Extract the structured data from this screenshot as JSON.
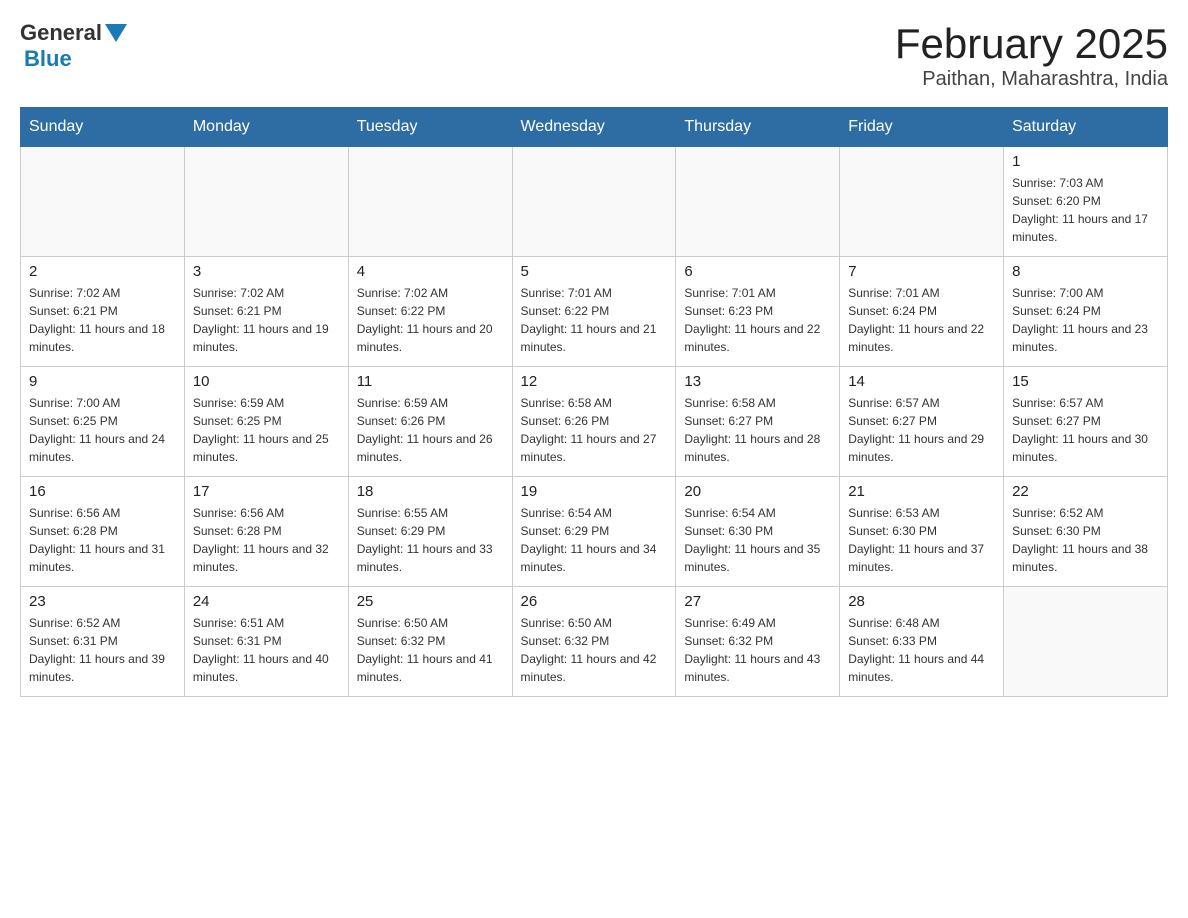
{
  "header": {
    "title": "February 2025",
    "subtitle": "Paithan, Maharashtra, India",
    "logo_general": "General",
    "logo_blue": "Blue"
  },
  "calendar": {
    "weekdays": [
      "Sunday",
      "Monday",
      "Tuesday",
      "Wednesday",
      "Thursday",
      "Friday",
      "Saturday"
    ],
    "weeks": [
      [
        {
          "day": "",
          "info": ""
        },
        {
          "day": "",
          "info": ""
        },
        {
          "day": "",
          "info": ""
        },
        {
          "day": "",
          "info": ""
        },
        {
          "day": "",
          "info": ""
        },
        {
          "day": "",
          "info": ""
        },
        {
          "day": "1",
          "info": "Sunrise: 7:03 AM\nSunset: 6:20 PM\nDaylight: 11 hours and 17 minutes."
        }
      ],
      [
        {
          "day": "2",
          "info": "Sunrise: 7:02 AM\nSunset: 6:21 PM\nDaylight: 11 hours and 18 minutes."
        },
        {
          "day": "3",
          "info": "Sunrise: 7:02 AM\nSunset: 6:21 PM\nDaylight: 11 hours and 19 minutes."
        },
        {
          "day": "4",
          "info": "Sunrise: 7:02 AM\nSunset: 6:22 PM\nDaylight: 11 hours and 20 minutes."
        },
        {
          "day": "5",
          "info": "Sunrise: 7:01 AM\nSunset: 6:22 PM\nDaylight: 11 hours and 21 minutes."
        },
        {
          "day": "6",
          "info": "Sunrise: 7:01 AM\nSunset: 6:23 PM\nDaylight: 11 hours and 22 minutes."
        },
        {
          "day": "7",
          "info": "Sunrise: 7:01 AM\nSunset: 6:24 PM\nDaylight: 11 hours and 22 minutes."
        },
        {
          "day": "8",
          "info": "Sunrise: 7:00 AM\nSunset: 6:24 PM\nDaylight: 11 hours and 23 minutes."
        }
      ],
      [
        {
          "day": "9",
          "info": "Sunrise: 7:00 AM\nSunset: 6:25 PM\nDaylight: 11 hours and 24 minutes."
        },
        {
          "day": "10",
          "info": "Sunrise: 6:59 AM\nSunset: 6:25 PM\nDaylight: 11 hours and 25 minutes."
        },
        {
          "day": "11",
          "info": "Sunrise: 6:59 AM\nSunset: 6:26 PM\nDaylight: 11 hours and 26 minutes."
        },
        {
          "day": "12",
          "info": "Sunrise: 6:58 AM\nSunset: 6:26 PM\nDaylight: 11 hours and 27 minutes."
        },
        {
          "day": "13",
          "info": "Sunrise: 6:58 AM\nSunset: 6:27 PM\nDaylight: 11 hours and 28 minutes."
        },
        {
          "day": "14",
          "info": "Sunrise: 6:57 AM\nSunset: 6:27 PM\nDaylight: 11 hours and 29 minutes."
        },
        {
          "day": "15",
          "info": "Sunrise: 6:57 AM\nSunset: 6:27 PM\nDaylight: 11 hours and 30 minutes."
        }
      ],
      [
        {
          "day": "16",
          "info": "Sunrise: 6:56 AM\nSunset: 6:28 PM\nDaylight: 11 hours and 31 minutes."
        },
        {
          "day": "17",
          "info": "Sunrise: 6:56 AM\nSunset: 6:28 PM\nDaylight: 11 hours and 32 minutes."
        },
        {
          "day": "18",
          "info": "Sunrise: 6:55 AM\nSunset: 6:29 PM\nDaylight: 11 hours and 33 minutes."
        },
        {
          "day": "19",
          "info": "Sunrise: 6:54 AM\nSunset: 6:29 PM\nDaylight: 11 hours and 34 minutes."
        },
        {
          "day": "20",
          "info": "Sunrise: 6:54 AM\nSunset: 6:30 PM\nDaylight: 11 hours and 35 minutes."
        },
        {
          "day": "21",
          "info": "Sunrise: 6:53 AM\nSunset: 6:30 PM\nDaylight: 11 hours and 37 minutes."
        },
        {
          "day": "22",
          "info": "Sunrise: 6:52 AM\nSunset: 6:30 PM\nDaylight: 11 hours and 38 minutes."
        }
      ],
      [
        {
          "day": "23",
          "info": "Sunrise: 6:52 AM\nSunset: 6:31 PM\nDaylight: 11 hours and 39 minutes."
        },
        {
          "day": "24",
          "info": "Sunrise: 6:51 AM\nSunset: 6:31 PM\nDaylight: 11 hours and 40 minutes."
        },
        {
          "day": "25",
          "info": "Sunrise: 6:50 AM\nSunset: 6:32 PM\nDaylight: 11 hours and 41 minutes."
        },
        {
          "day": "26",
          "info": "Sunrise: 6:50 AM\nSunset: 6:32 PM\nDaylight: 11 hours and 42 minutes."
        },
        {
          "day": "27",
          "info": "Sunrise: 6:49 AM\nSunset: 6:32 PM\nDaylight: 11 hours and 43 minutes."
        },
        {
          "day": "28",
          "info": "Sunrise: 6:48 AM\nSunset: 6:33 PM\nDaylight: 11 hours and 44 minutes."
        },
        {
          "day": "",
          "info": ""
        }
      ]
    ]
  }
}
